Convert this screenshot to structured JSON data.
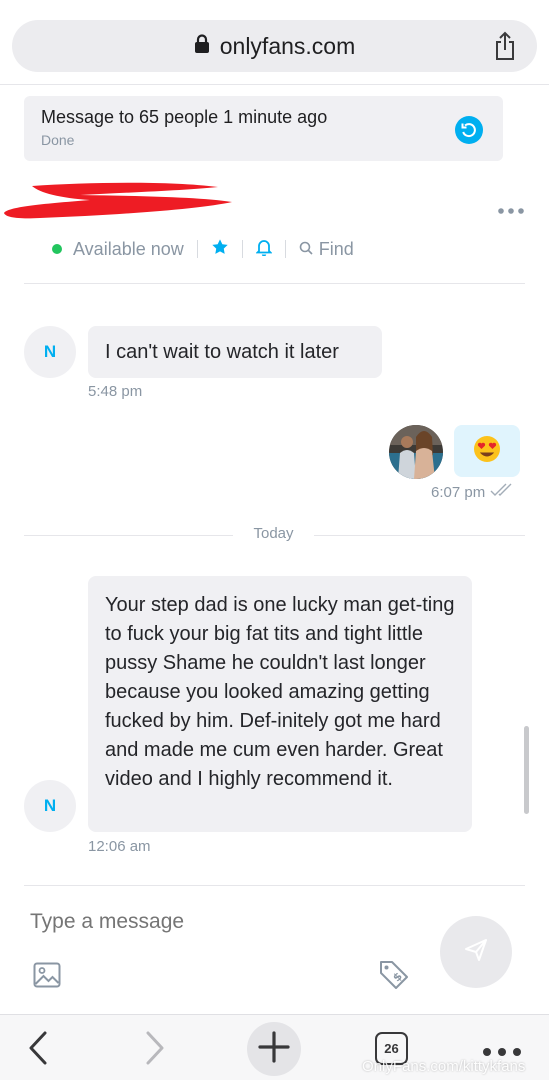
{
  "browser": {
    "url": "onlyfans.com",
    "lock_icon": "lock-icon",
    "share_icon": "share-icon"
  },
  "toast": {
    "title": "Message to 65 people 1 minute ago",
    "status": "Done",
    "undo_icon": "undo-icon"
  },
  "header": {
    "status": "Available now",
    "find_label": "Find",
    "more_icon": "more-icon",
    "star_icon": "star-icon",
    "bell_icon": "bell-icon",
    "search_icon": "search-icon"
  },
  "messages": [
    {
      "from": "N",
      "text": "I can't wait to watch it later",
      "time": "5:48 pm"
    },
    {
      "from": "me",
      "emoji": "😍",
      "time": "6:07 pm"
    },
    {
      "from": "N",
      "text": "Your step dad is one lucky man get-ting to fuck your big fat tits and tight little pussy Shame he couldn't last longer because you looked amazing getting fucked by him. Def-initely got me hard and made me cum even harder. Great video and I highly recommend it.",
      "time": "12:06 am"
    }
  ],
  "divider_label": "Today",
  "composer": {
    "placeholder": "Type a message",
    "image_icon": "image-icon",
    "price_tag_icon": "price-tag-icon",
    "send_icon": "send-icon"
  },
  "toolbar": {
    "tab_count": "26"
  },
  "watermark": "OnlyFans.com/kittykfans",
  "colors": {
    "accent": "#00aff0",
    "online": "#22c55e",
    "muted": "#8a96a3",
    "bubble_in": "#f0f0f3",
    "bubble_out": "#e0f4fd"
  }
}
